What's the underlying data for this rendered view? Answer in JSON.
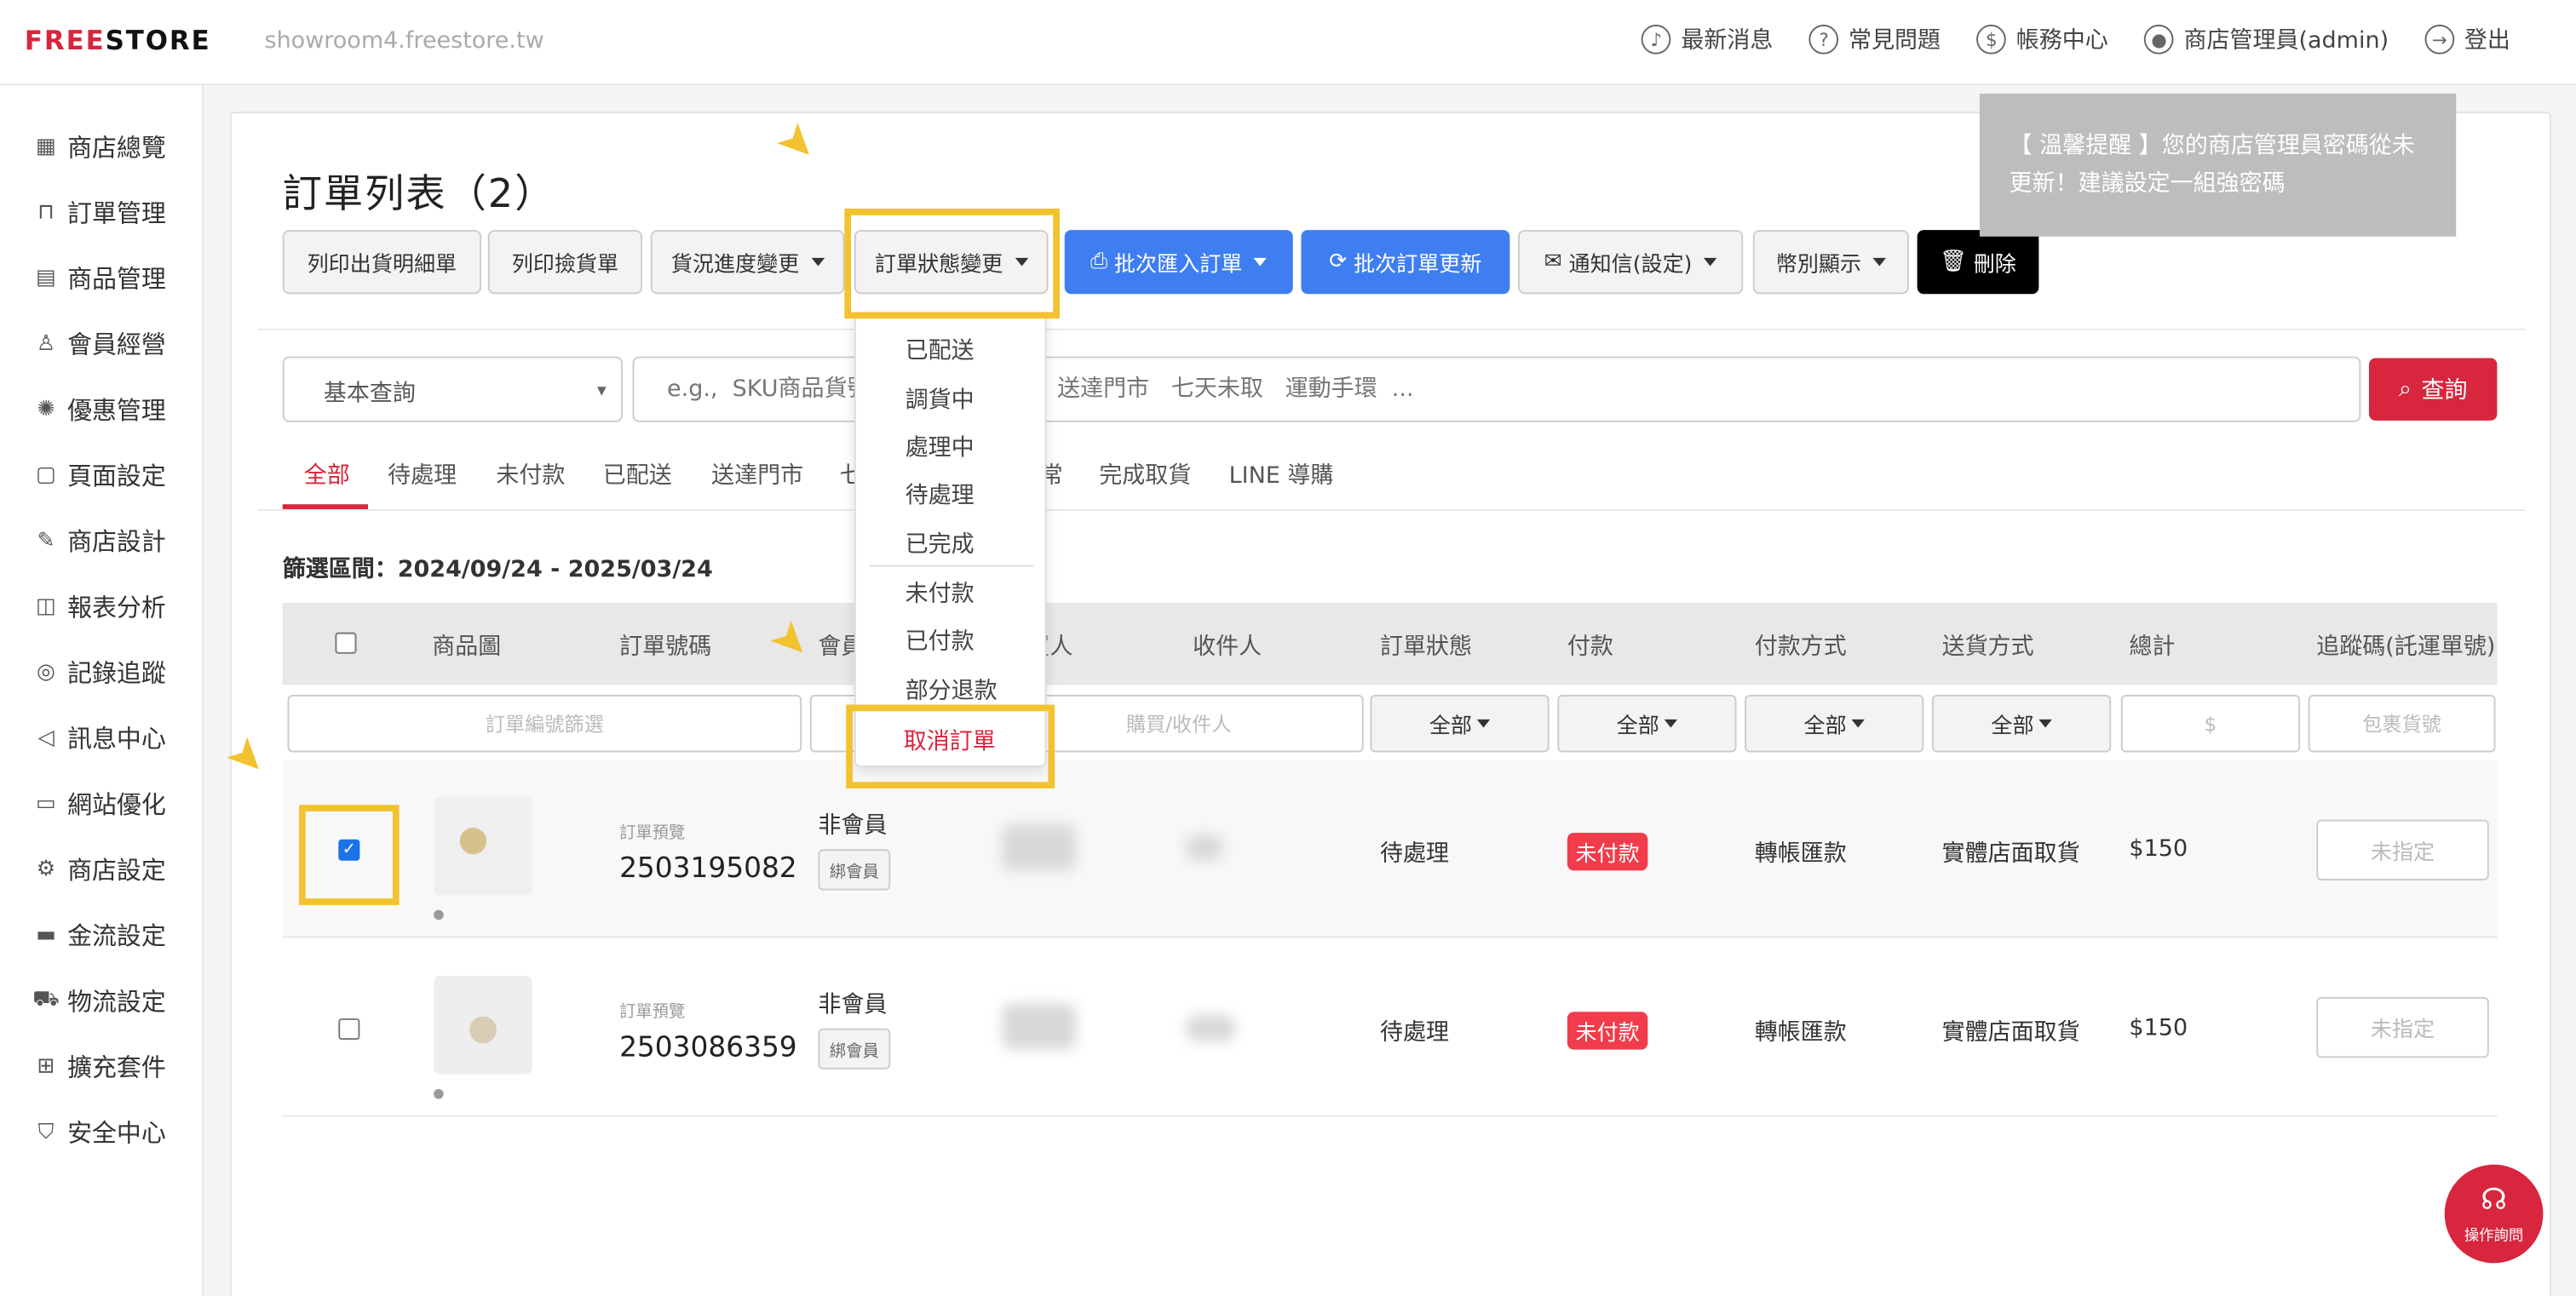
{
  "topbar": {
    "logo_left": "FREE",
    "logo_right": "STORE",
    "domain": "showroom4.freestore.tw",
    "nav": [
      {
        "label": "最新消息",
        "icon": "bell-icon"
      },
      {
        "label": "常見問題",
        "icon": "question-icon"
      },
      {
        "label": "帳務中心",
        "icon": "dollar-icon"
      },
      {
        "label": "商店管理員(admin)",
        "icon": "user-icon"
      },
      {
        "label": "登出",
        "icon": "logout-icon"
      }
    ]
  },
  "sidebar": {
    "items": [
      {
        "label": "商店總覽",
        "icon": "grid-icon"
      },
      {
        "label": "訂單管理",
        "icon": "basket-icon"
      },
      {
        "label": "商品管理",
        "icon": "clipboard-icon"
      },
      {
        "label": "會員經營",
        "icon": "person-icon"
      },
      {
        "label": "優惠管理",
        "icon": "discount-icon"
      },
      {
        "label": "頁面設定",
        "icon": "page-icon"
      },
      {
        "label": "商店設計",
        "icon": "paint-icon"
      },
      {
        "label": "報表分析",
        "icon": "chart-icon"
      },
      {
        "label": "記錄追蹤",
        "icon": "target-icon"
      },
      {
        "label": "訊息中心",
        "icon": "megaphone-icon"
      },
      {
        "label": "網站優化",
        "icon": "monitor-icon"
      },
      {
        "label": "商店設定",
        "icon": "gear-icon"
      },
      {
        "label": "金流設定",
        "icon": "card-icon"
      },
      {
        "label": "物流設定",
        "icon": "truck-icon"
      },
      {
        "label": "擴充套件",
        "icon": "puzzle-icon"
      },
      {
        "label": "安全中心",
        "icon": "shield-icon"
      }
    ]
  },
  "page": {
    "title": "訂單列表（2）"
  },
  "toolbar": {
    "print_shipping": "列印出貨明細單",
    "print_picking": "列印撿貨單",
    "shipping_progress": "貨況進度變更",
    "order_status": "訂單狀態變更",
    "batch_import": "批次匯入訂單",
    "batch_update": "批次訂單更新",
    "notify": "通知信(設定)",
    "currency": "幣別顯示",
    "delete": "刪除"
  },
  "toast": {
    "text": "【 溫馨提醒 】您的商店管理員密碼從未更新！建議設定一組強密碼"
  },
  "search": {
    "select_value": "基本查詢",
    "placeholder": "e.g.,  SKU商品貨號     黑貓     全家   送達門市   七天未取   運動手環  ...",
    "button": "查詢"
  },
  "filter_tabs": [
    "全部",
    "待處理",
    "未付款",
    "已配送",
    "送達門市",
    "七",
    "常",
    "完成取貨",
    "LINE 導購"
  ],
  "range_text": "篩選區間：2024/09/24 - 2025/03/24",
  "table": {
    "headers": {
      "image": "商品圖",
      "order_no": "訂單號碼",
      "member": "會員",
      "buyer": "購買人",
      "receiver": "收件人",
      "status": "訂單狀態",
      "payment": "付款",
      "pay_method": "付款方式",
      "ship_method": "送貨方式",
      "total": "總計",
      "tracking": "追蹤碼(託運單號)"
    },
    "filters": {
      "order_no_placeholder": "訂單編號篩選",
      "buyer_placeholder": "購買/收件人",
      "status": "全部",
      "payment": "全部",
      "pay_method": "全部",
      "ship_method": "全部",
      "total_placeholder": "$",
      "tracking_placeholder": "包裹貨號"
    },
    "rows": [
      {
        "label": "訂單預覽",
        "order_no": "2503195082",
        "member": "非會員",
        "bind": "綁會員",
        "status": "待處理",
        "payment": "未付款",
        "pay_method": "轉帳匯款",
        "ship_method": "實體店面取貨",
        "total": "$150",
        "assign": "未指定",
        "checked": true
      },
      {
        "label": "訂單預覽",
        "order_no": "2503086359",
        "member": "非會員",
        "bind": "綁會員",
        "status": "待處理",
        "payment": "未付款",
        "pay_method": "轉帳匯款",
        "ship_method": "實體店面取貨",
        "total": "$150",
        "assign": "未指定",
        "checked": false
      }
    ]
  },
  "status_dropdown": {
    "items": [
      "已配送",
      "調貨中",
      "處理中",
      "待處理",
      "已完成",
      "未付款",
      "已付款",
      "部分退款",
      "取消訂單"
    ]
  },
  "help": {
    "label": "操作詢問"
  },
  "colors": {
    "accent_red": "#d7263d",
    "blue": "#3f7ef0",
    "highlight_yellow": "#f2c230",
    "badge_red": "#f03c4b"
  }
}
